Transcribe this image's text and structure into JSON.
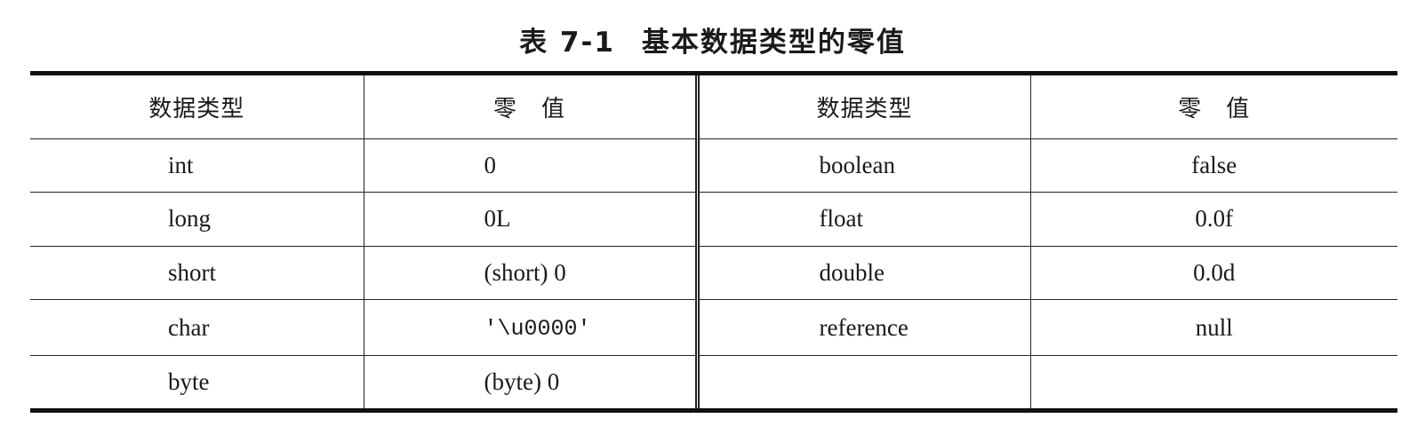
{
  "caption": {
    "number": "表 7-1",
    "title": "基本数据类型的零值"
  },
  "table": {
    "headers": [
      "数据类型",
      "零　值",
      "数据类型",
      "零　值"
    ],
    "rows": [
      {
        "left_type": "int",
        "left_zero": "0",
        "right_type": "boolean",
        "right_zero": "false"
      },
      {
        "left_type": "long",
        "left_zero": "0L",
        "right_type": "float",
        "right_zero": "0.0f"
      },
      {
        "left_type": "short",
        "left_zero": "(short) 0",
        "right_type": "double",
        "right_zero": "0.0d"
      },
      {
        "left_type": "char",
        "left_zero": "'\\u0000'",
        "right_type": "reference",
        "right_zero": "null"
      },
      {
        "left_type": "byte",
        "left_zero": "(byte) 0",
        "right_type": "",
        "right_zero": ""
      }
    ]
  }
}
